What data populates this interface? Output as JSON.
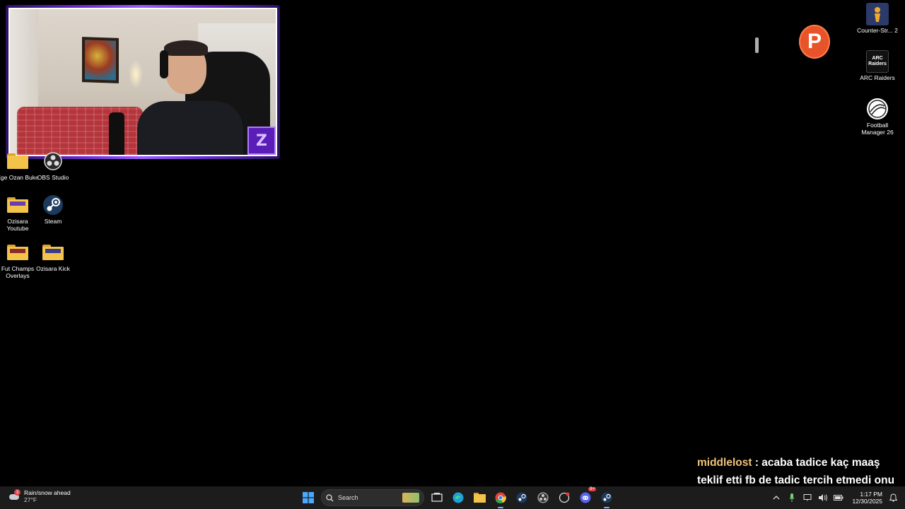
{
  "desktop": {
    "left_icons": [
      {
        "label": "Ege Ozan Buke",
        "icon": "folder-icon"
      },
      {
        "label": "OBS Studio",
        "icon": "obs-icon"
      },
      {
        "label": "Ozisara Youtube",
        "icon": "folder-icon"
      },
      {
        "label": "Steam",
        "icon": "steam-icon"
      },
      {
        "label": "Fut Champs Overlays",
        "icon": "folder-icon"
      },
      {
        "label": "Ozisara Kick",
        "icon": "folder-icon"
      }
    ],
    "right_icons": [
      {
        "label": "Counter-Str... 2",
        "icon": "counter-strike-icon"
      },
      {
        "label": "ARC Raiders",
        "icon": "arc-raiders-icon",
        "glyph_text": "ARC Raiders"
      },
      {
        "label": "Football Manager 26",
        "icon": "football-manager-icon"
      }
    ],
    "floating_badge": {
      "letter": "P",
      "color": "#e8542a"
    }
  },
  "webcam": {
    "logo_letter": "Z",
    "accent": "#6b2fd8"
  },
  "chat": {
    "username": "middlelost",
    "separator": " : ",
    "message": "acaba tadice kaç maaş teklif etti fb de tadic tercih etmedi onu merak etim"
  },
  "taskbar": {
    "weather": {
      "alert_count": "3",
      "condition": "Rain/snow ahead",
      "temperature": "27°F"
    },
    "search": {
      "placeholder": "Search"
    },
    "apps": [
      {
        "name": "start-button",
        "icon": "windows-icon"
      },
      {
        "name": "task-view",
        "icon": "task-view-icon"
      },
      {
        "name": "edge",
        "icon": "edge-icon"
      },
      {
        "name": "file-explorer",
        "icon": "folder-icon"
      },
      {
        "name": "chrome",
        "icon": "chrome-icon"
      },
      {
        "name": "steam",
        "icon": "steam-icon"
      },
      {
        "name": "obs",
        "icon": "obs-icon"
      },
      {
        "name": "game-app",
        "icon": "game-icon"
      },
      {
        "name": "discord",
        "icon": "discord-icon",
        "badge": "9+"
      },
      {
        "name": "steam-active",
        "icon": "steam-icon"
      }
    ],
    "clock": {
      "time": "1:17 PM",
      "date": "12/30/2025"
    }
  }
}
